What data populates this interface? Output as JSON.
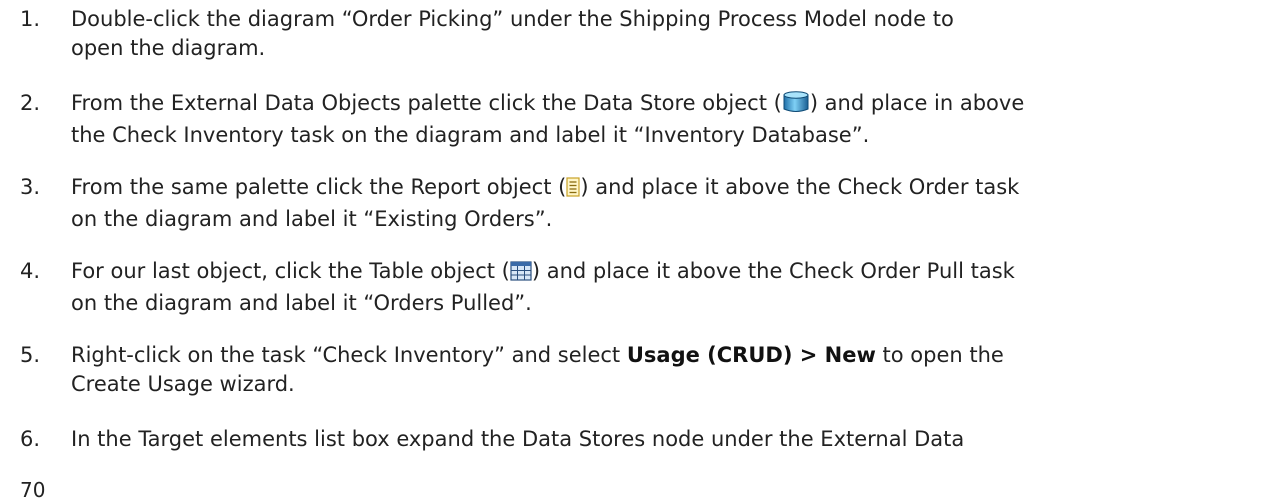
{
  "steps": [
    {
      "num": "1.",
      "line1": "Double-click the diagram “Order Picking” under the Shipping Process Model node to",
      "line2": "open the diagram."
    },
    {
      "num": "2.",
      "line1_a": "From the External Data Objects palette click the Data Store object (",
      "line1_b": ") and place in above",
      "line2": "the Check Inventory task on the diagram and label it “Inventory Database”.",
      "icon": "data-store-icon"
    },
    {
      "num": "3.",
      "line1_a": "From the same palette click the Report object (",
      "line1_b": ") and place it above the Check Order task",
      "line2": "on the diagram and label it “Existing Orders”.",
      "icon": "report-icon"
    },
    {
      "num": "4.",
      "line1_a": "For our last object, click the Table object (",
      "line1_b": ") and place it above the Check Order Pull task",
      "line2": "on the diagram and label it “Orders Pulled”.",
      "icon": "table-icon"
    },
    {
      "num": "5.",
      "line1_a": "Right-click on the task “Check Inventory” and select ",
      "line1_bold": "Usage (CRUD) > New",
      "line1_b": " to open the",
      "line2": "Create Usage wizard."
    },
    {
      "num": "6.",
      "line1": "In the Target elements list box expand the Data Stores node under the External Data"
    }
  ],
  "page_number": "70"
}
